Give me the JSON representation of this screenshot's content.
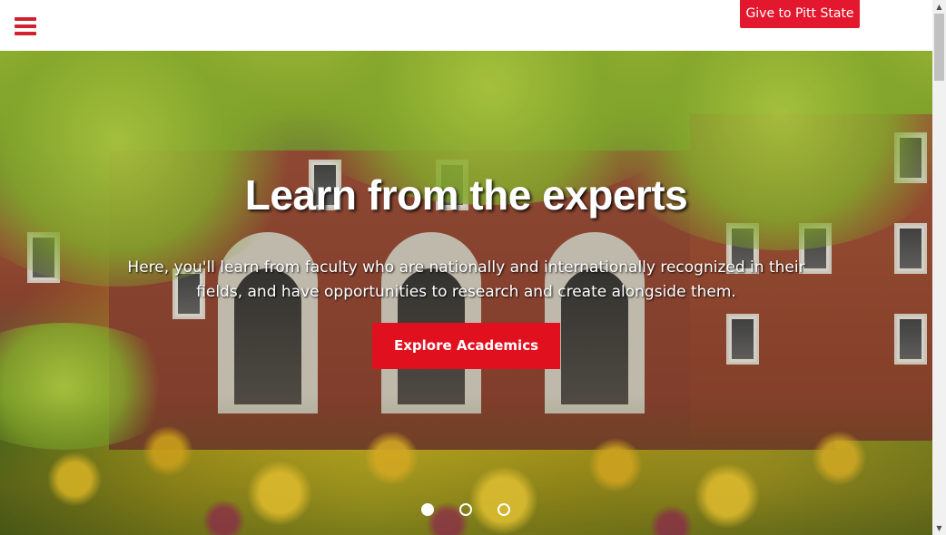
{
  "header": {
    "menu_icon": "hamburger-menu-icon",
    "give_button_label": "Give to Pitt State"
  },
  "hero": {
    "title": "Learn from the experts",
    "text": "Here, you'll learn from faculty who are nationally and internationally recognized in their fields, and have opportunities to research and create alongside them.",
    "cta_label": "Explore Academics",
    "slides_count": 3,
    "active_slide": 1
  },
  "scrollbar": {
    "up_arrow": "▲",
    "down_arrow": "▼"
  },
  "colors": {
    "accent_red": "#e0101f",
    "menu_red": "#d2202f",
    "white": "#ffffff"
  }
}
